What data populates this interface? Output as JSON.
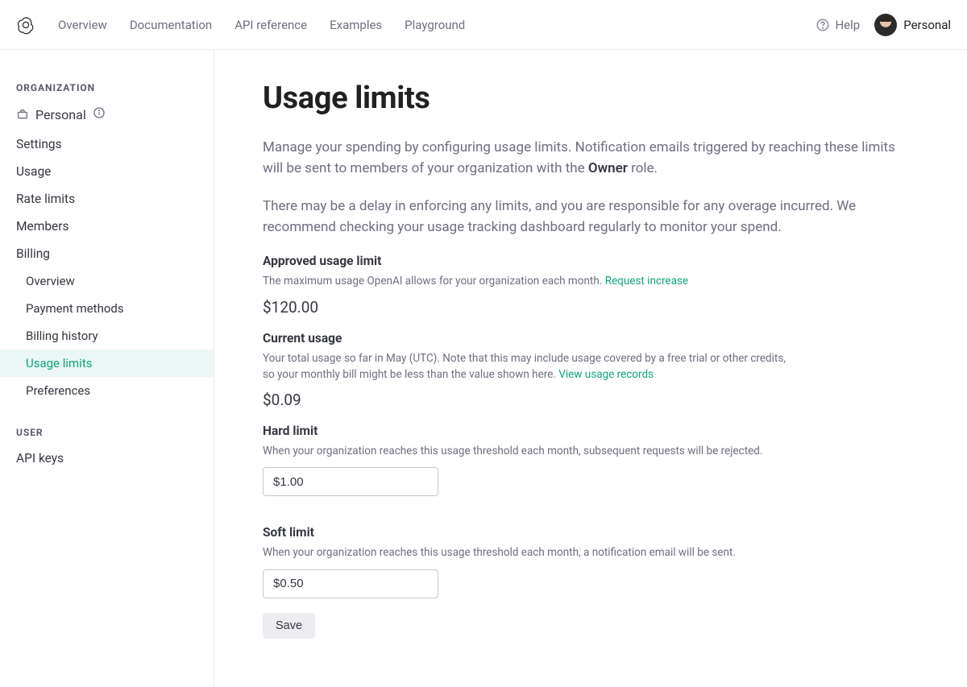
{
  "header": {
    "nav": {
      "overview": "Overview",
      "documentation": "Documentation",
      "api_reference": "API reference",
      "examples": "Examples",
      "playground": "Playground"
    },
    "help": "Help",
    "account_label": "Personal"
  },
  "sidebar": {
    "org_label": "ORGANIZATION",
    "org_name": "Personal",
    "links": {
      "settings": "Settings",
      "usage": "Usage",
      "rate_limits": "Rate limits",
      "members": "Members",
      "billing": "Billing"
    },
    "billing_sub": {
      "overview": "Overview",
      "payment_methods": "Payment methods",
      "billing_history": "Billing history",
      "usage_limits": "Usage limits",
      "preferences": "Preferences"
    },
    "user_label": "USER",
    "user_links": {
      "api_keys": "API keys"
    }
  },
  "page": {
    "title": "Usage limits",
    "intro1_a": "Manage your spending by configuring usage limits. Notification emails triggered by reaching these limits will be sent to members of your organization with the ",
    "intro1_b": "Owner",
    "intro1_c": " role.",
    "intro2": "There may be a delay in enforcing any limits, and you are responsible for any overage incurred. We recommend checking your usage tracking dashboard regularly to monitor your spend.",
    "approved": {
      "heading": "Approved usage limit",
      "desc": "The maximum usage OpenAI allows for your organization each month. ",
      "link": "Request increase",
      "value": "$120.00"
    },
    "current": {
      "heading": "Current usage",
      "desc": "Your total usage so far in May (UTC). Note that this may include usage covered by a free trial or other credits, so your monthly bill might be less than the value shown here. ",
      "link": "View usage records",
      "value": "$0.09"
    },
    "hard": {
      "heading": "Hard limit",
      "desc": "When your organization reaches this usage threshold each month, subsequent requests will be rejected.",
      "value": "$1.00"
    },
    "soft": {
      "heading": "Soft limit",
      "desc": "When your organization reaches this usage threshold each month, a notification email will be sent.",
      "value": "$0.50"
    },
    "save": "Save"
  }
}
